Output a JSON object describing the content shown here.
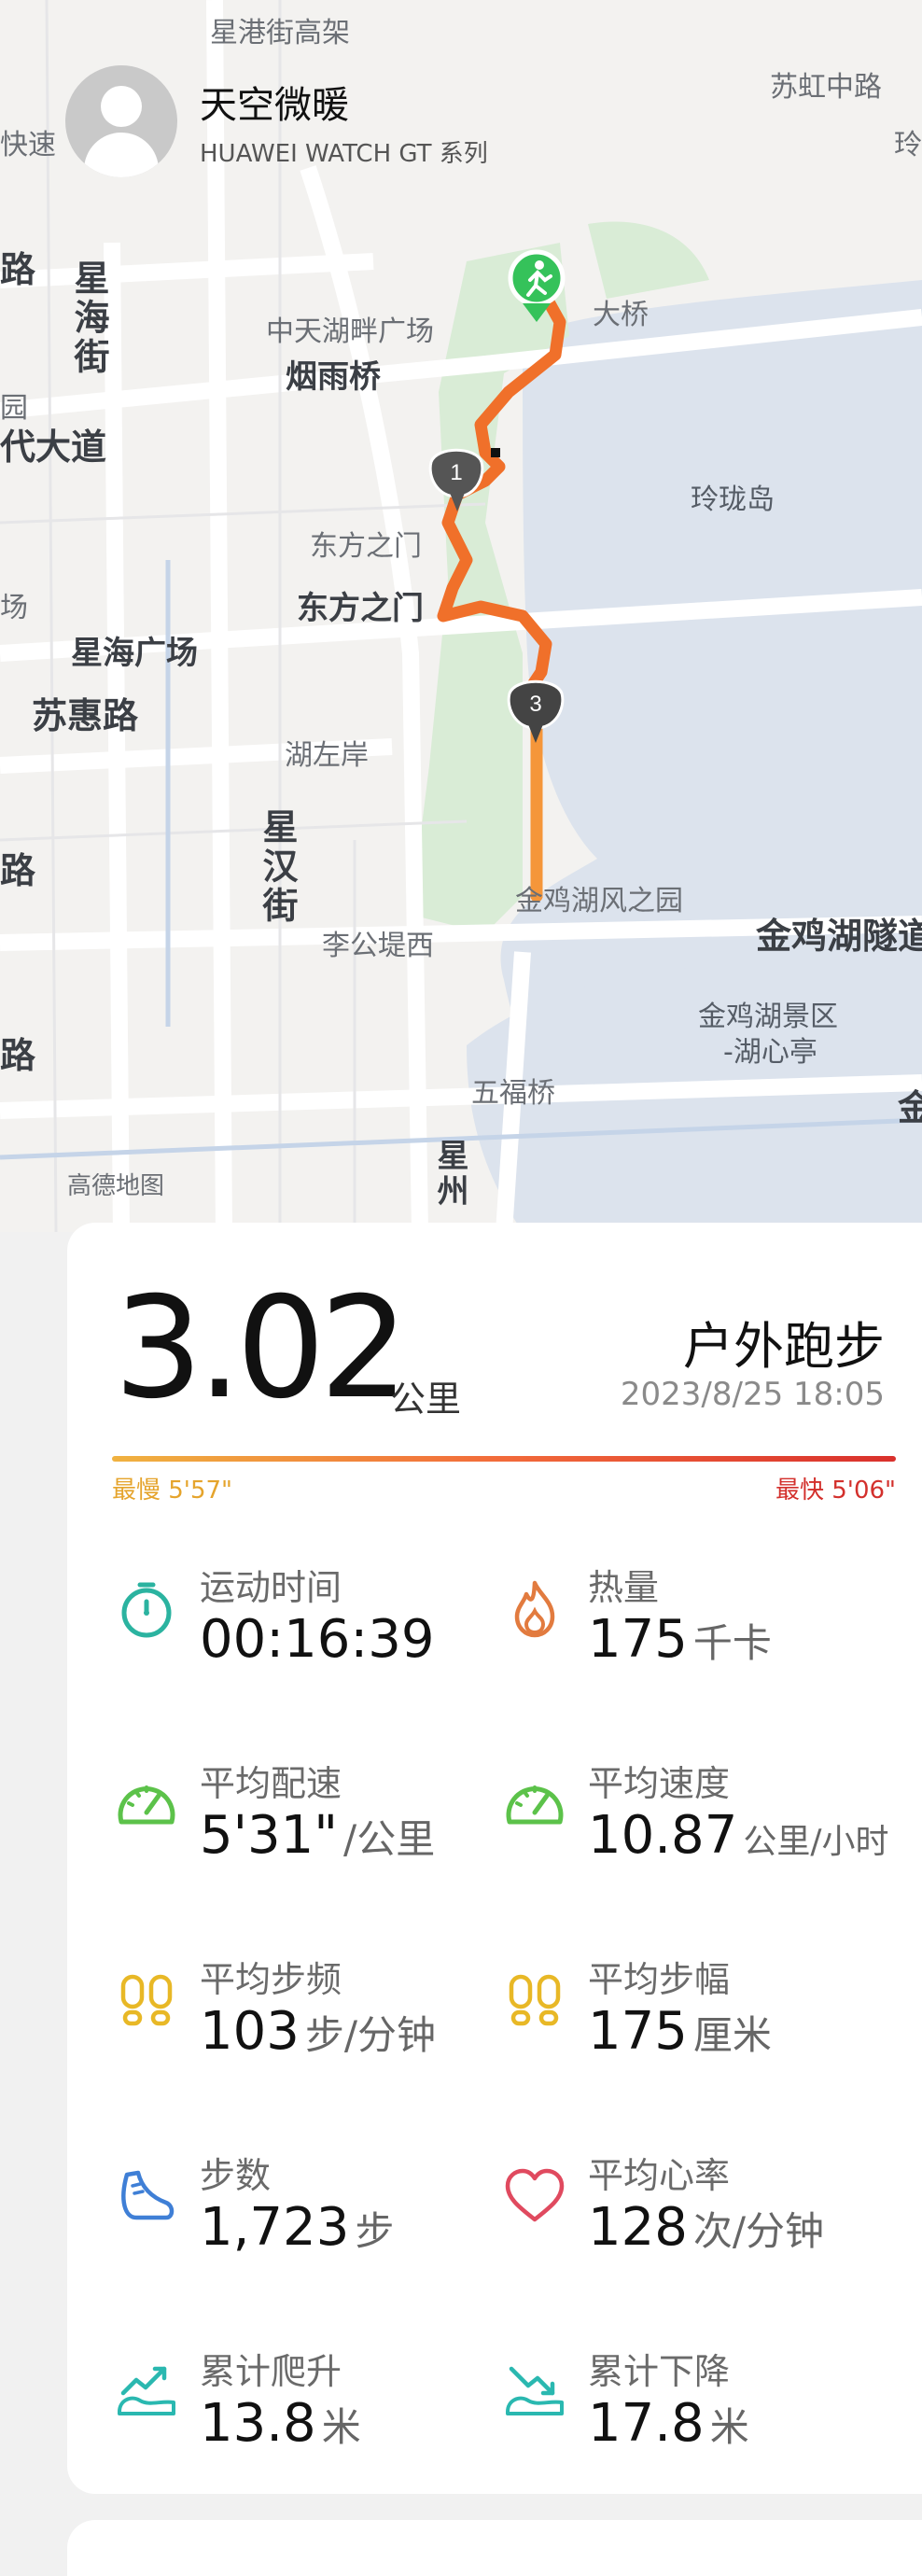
{
  "map": {
    "labels": [
      "星港街高架",
      "苏虹中路",
      "快速",
      "玲",
      "中天湖畔广场",
      "大桥",
      "烟雨桥",
      "星海街",
      "路",
      "代大道",
      "园",
      "玲珑岛",
      "东方之门",
      "东方之门",
      "场",
      "星海广场",
      "苏惠路",
      "湖左岸",
      "星汉街",
      "路",
      "金鸡湖风之园",
      "金鸡湖隧道",
      "李公堤西",
      "金鸡湖景区",
      "-湖心亭",
      "路",
      "五福桥",
      "金",
      "高德地图",
      "星州",
      "场"
    ],
    "markers": [
      "1",
      "3"
    ],
    "colors": {
      "route": "#f0702a",
      "route_end": "#f5963a",
      "start": "#35c25a",
      "water": "#dce3ed",
      "green": "#d9ecd6"
    }
  },
  "header": {
    "user_name": "天空微暖",
    "device": "HUAWEI WATCH GT 系列"
  },
  "summary": {
    "distance": "3.02",
    "distance_unit": "公里",
    "sport_type": "户外跑步",
    "datetime": "2023/8/25 18:05",
    "slowest_label": "最慢 5'57\"",
    "fastest_label": "最快 5'06\""
  },
  "stats": [
    {
      "label": "运动时间",
      "value": "00:16:39",
      "unit": "",
      "icon": "stopwatch-icon",
      "color": "#2bb3a0"
    },
    {
      "label": "热量",
      "value": "175",
      "unit": "千卡",
      "icon": "flame-icon",
      "color": "#e27b3f"
    },
    {
      "label": "平均配速",
      "value": "5'31\"",
      "unit": "/公里",
      "icon": "speedometer-icon",
      "color": "#5cc24a"
    },
    {
      "label": "平均速度",
      "value": "10.87",
      "unit": "公里/小时",
      "icon": "speedometer-icon",
      "color": "#5cc24a"
    },
    {
      "label": "平均步频",
      "value": "103",
      "unit": "步/分钟",
      "icon": "footprints-icon",
      "color": "#e8b826"
    },
    {
      "label": "平均步幅",
      "value": "175",
      "unit": "厘米",
      "icon": "footprints-icon",
      "color": "#e8b826"
    },
    {
      "label": "步数",
      "value": "1,723",
      "unit": "步",
      "icon": "shoe-icon",
      "color": "#3f7fd6"
    },
    {
      "label": "平均心率",
      "value": "128",
      "unit": "次/分钟",
      "icon": "heart-icon",
      "color": "#e04a5f"
    },
    {
      "label": "累计爬升",
      "value": "13.8",
      "unit": "米",
      "icon": "climb-icon",
      "color": "#2ab8b0"
    },
    {
      "label": "累计下降",
      "value": "17.8",
      "unit": "米",
      "icon": "descent-icon",
      "color": "#2ab8b0"
    }
  ]
}
